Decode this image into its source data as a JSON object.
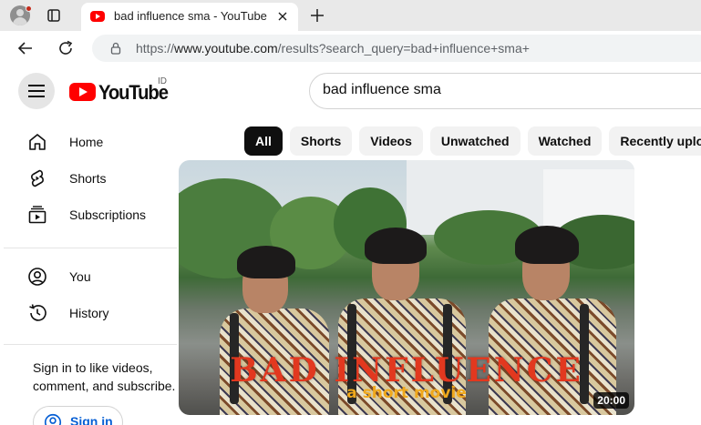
{
  "browser": {
    "tab_title": "bad influence sma - YouTube",
    "url_prefix": "https://",
    "url_host": "www.youtube.com",
    "url_path": "/results?search_query=bad+influence+sma+"
  },
  "youtube": {
    "logo_text": "YouTube",
    "country_code": "ID",
    "search_value": "bad influence sma",
    "sidebar": {
      "items": [
        {
          "label": "Home",
          "icon": "home-icon"
        },
        {
          "label": "Shorts",
          "icon": "shorts-icon"
        },
        {
          "label": "Subscriptions",
          "icon": "subscriptions-icon"
        },
        {
          "label": "You",
          "icon": "user-circle-icon"
        },
        {
          "label": "History",
          "icon": "history-icon"
        }
      ],
      "signin_prompt": "Sign in to like videos, comment, and subscribe.",
      "signin_button": "Sign in"
    },
    "chips": [
      "All",
      "Shorts",
      "Videos",
      "Unwatched",
      "Watched",
      "Recently uploaded"
    ],
    "active_chip": "All",
    "video": {
      "thumbnail_title": "BAD INFLUENCE",
      "thumbnail_subtitle": "a short movie",
      "duration": "20:00"
    }
  },
  "colors": {
    "brand_red": "#ff0000",
    "link_blue": "#065fd4",
    "chip_active": "#0f0f0f"
  }
}
